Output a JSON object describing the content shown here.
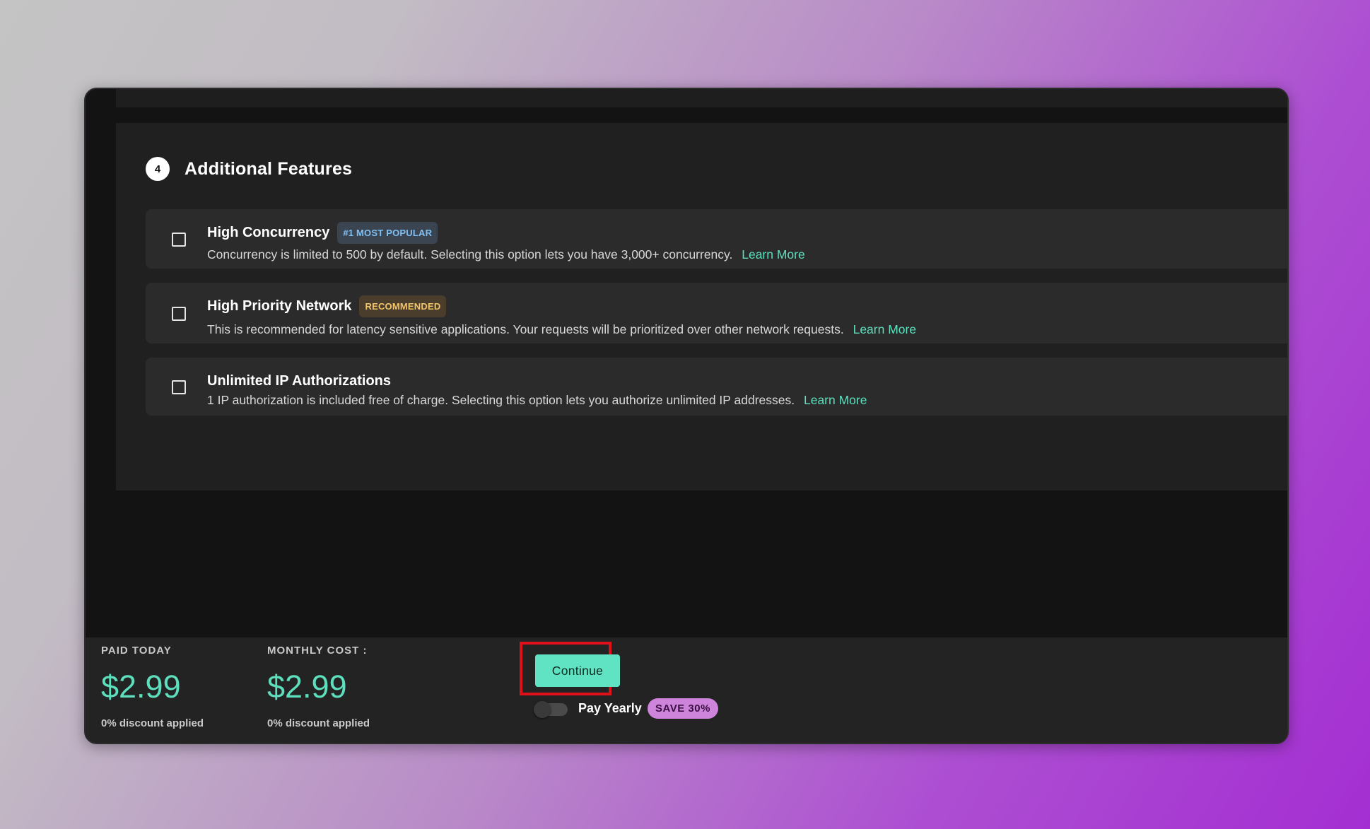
{
  "section": {
    "step_number": "4",
    "title": "Additional Features"
  },
  "features": [
    {
      "title": "High Concurrency",
      "badge": "#1 MOST POPULAR",
      "description": "Concurrency is limited to 500 by default. Selecting this option lets you have 3,000+ concurrency.",
      "link": "Learn More",
      "checked": false
    },
    {
      "title": "High Priority Network",
      "badge": "RECOMMENDED",
      "description": "This is recommended for latency sensitive applications. Your requests will be prioritized over other network requests.",
      "link": "Learn More",
      "checked": false
    },
    {
      "title": "Unlimited IP Authorizations",
      "badge": "",
      "description": "1 IP authorization is included free of charge. Selecting this option lets you authorize unlimited IP addresses.",
      "link": "Learn More",
      "checked": false
    }
  ],
  "footer": {
    "paid_today": {
      "label": "PAID TODAY",
      "amount": "$2.99",
      "discount": "0% discount applied"
    },
    "monthly_cost": {
      "label": "MONTHLY COST :",
      "amount": "$2.99",
      "discount": "0% discount applied"
    },
    "continue_label": "Continue",
    "pay_yearly_label": "Pay Yearly",
    "pay_yearly_enabled": false,
    "save_badge": "SAVE 30%"
  },
  "colors": {
    "accent": "#5ddfbd",
    "button": "#5fe3c2",
    "highlight": "#e0101a",
    "save_badge": "#cf84dc",
    "badge_popular_text": "#7fc0f4",
    "badge_recommended_text": "#f2c46a"
  },
  "icons": {
    "step": "step-number-circle",
    "checkbox": "checkbox-unchecked",
    "toggle": "toggle-off"
  }
}
